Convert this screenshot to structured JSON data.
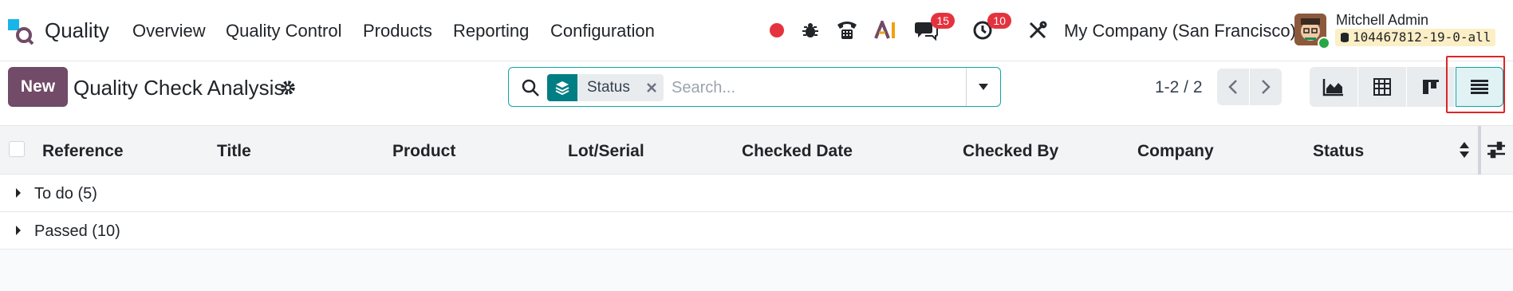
{
  "navbar": {
    "app_name": "Quality",
    "menu": [
      "Overview",
      "Quality Control",
      "Products",
      "Reporting",
      "Configuration"
    ],
    "messages_count": "15",
    "activities_count": "10",
    "company": "My Company (San Francisco)",
    "user_name": "Mitchell Admin",
    "database": "104467812-19-0-all",
    "recording_color": "#e4333f",
    "brand_color": "#714b67",
    "accent_color": "#017e84"
  },
  "control_panel": {
    "new_label": "New",
    "title": "Quality Check Analysis",
    "search": {
      "facet_label": "Status",
      "placeholder": "Search..."
    },
    "pager": "1-2 / 2",
    "views": [
      "graph-view",
      "pivot-view",
      "kanban-view",
      "list-view"
    ],
    "active_view": "list-view"
  },
  "list": {
    "columns": [
      "Reference",
      "Title",
      "Product",
      "Lot/Serial",
      "Checked Date",
      "Checked By",
      "Company",
      "Status"
    ],
    "groups": [
      {
        "label": "To do (5)"
      },
      {
        "label": "Passed (10)"
      }
    ]
  }
}
